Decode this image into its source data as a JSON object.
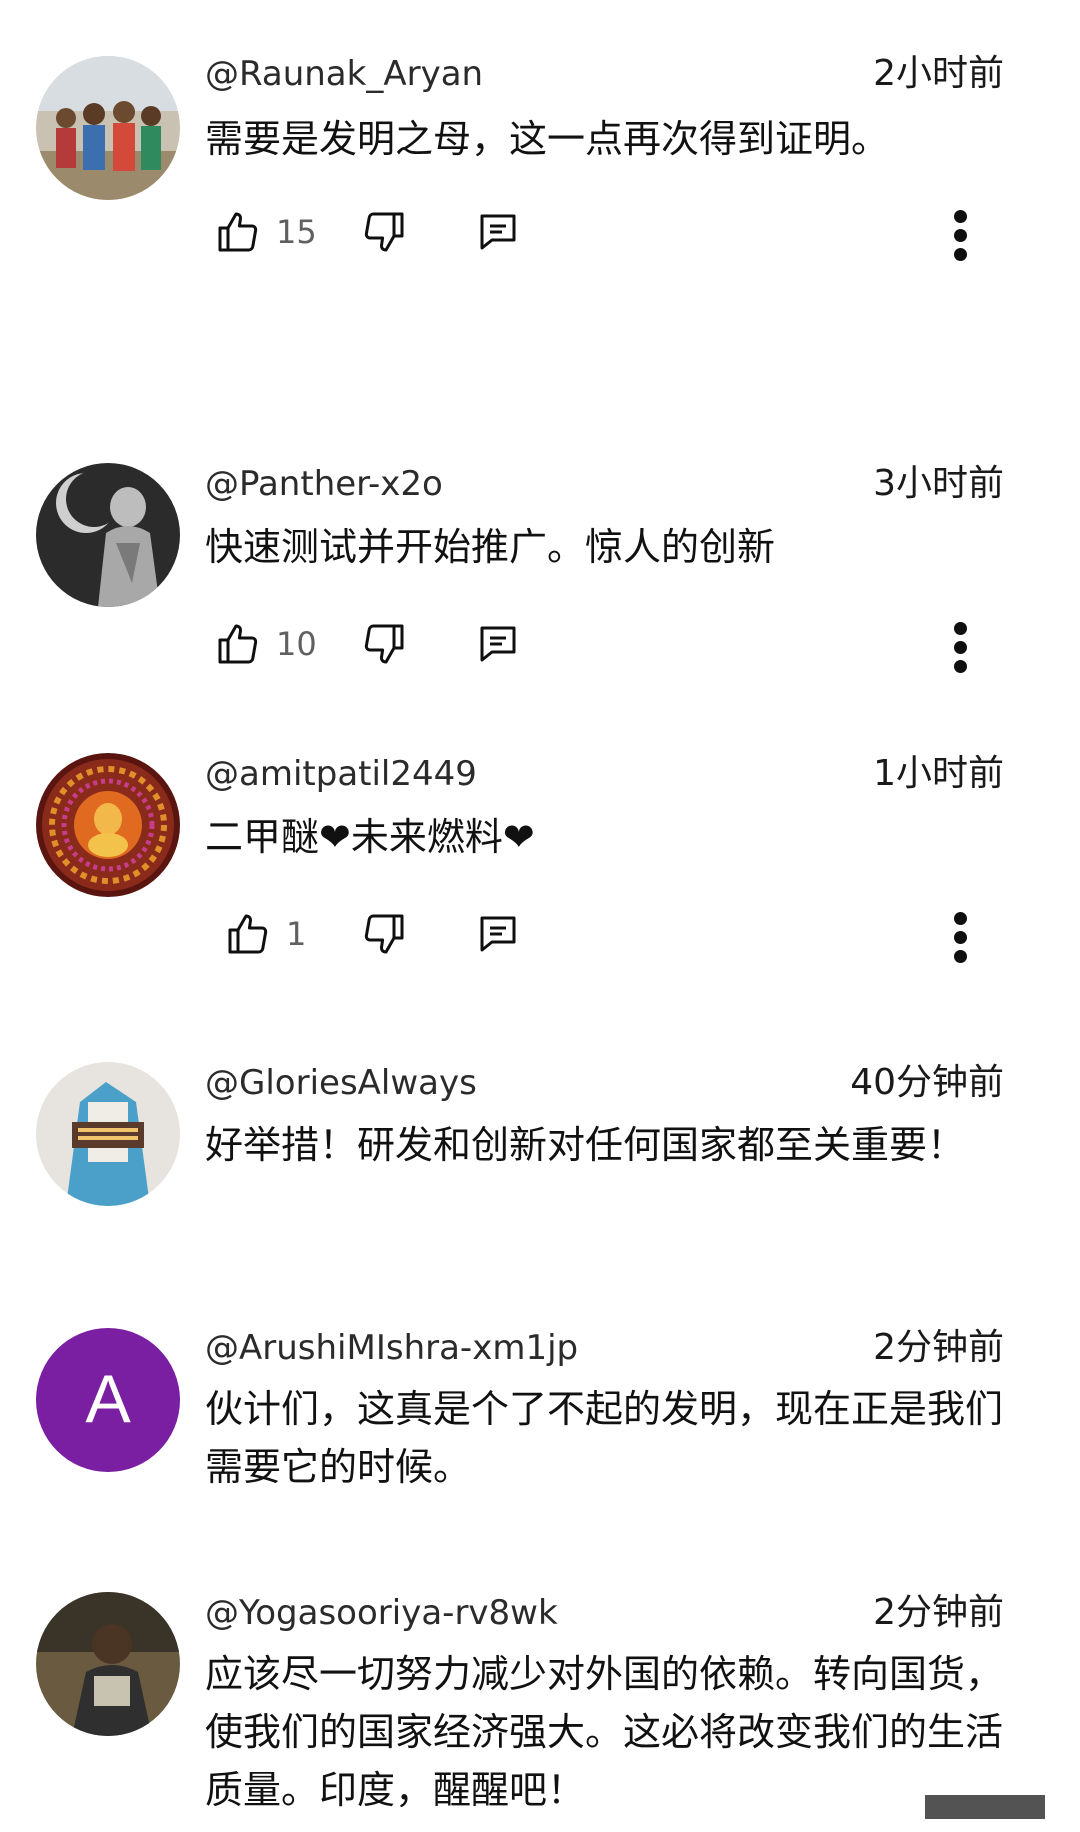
{
  "comments": [
    {
      "author": "@Raunak_Aryan",
      "time": "2小时前",
      "text": "需要是发明之母，这一点再次得到证明。",
      "likes": "15"
    },
    {
      "author": "@Panther-x2o",
      "time": "3小时前",
      "text": "快速测试并开始推广。惊人的创新",
      "likes": "10"
    },
    {
      "author": "@amitpatil2449",
      "time": "1小时前",
      "text": "二甲醚❤未来燃料❤",
      "likes": "1"
    },
    {
      "author": "@GloriesAlways",
      "time": "40分钟前",
      "text": "好举措！研发和创新对任何国家都至关重要！"
    },
    {
      "author": "@ArushiMIshra-xm1jp",
      "time": "2分钟前",
      "text": "伙计们，这真是个了不起的发明，现在正是我们需要它的时候。",
      "avatar_letter": "A",
      "avatar_color": "#7b1fa2"
    },
    {
      "author": "@Yogasooriya-rv8wk",
      "time": "2分钟前",
      "text": "应该尽一切努力减少对外国的依赖。转向国货，使我们的国家经济强大。这必将改变我们的生活质量。印度，醒醒吧！"
    }
  ],
  "icons": {
    "like": "thumbs-up-icon",
    "dislike": "thumbs-down-icon",
    "reply": "reply-comment-icon",
    "menu": "more-vertical-icon"
  }
}
